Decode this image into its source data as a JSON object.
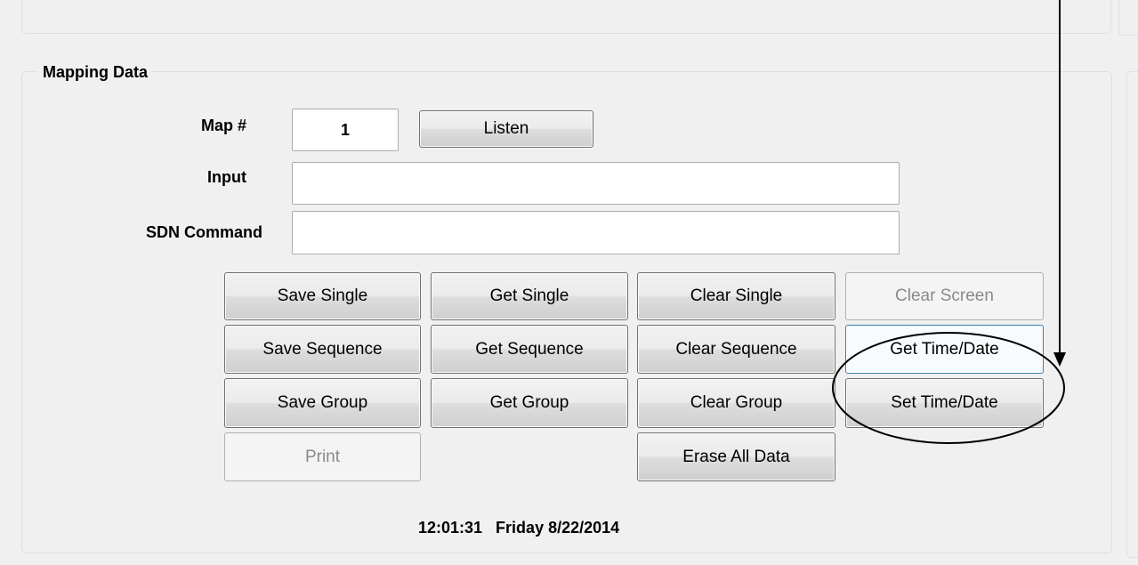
{
  "group": {
    "title": "Mapping Data"
  },
  "fields": {
    "map_label": "Map #",
    "map_value": "1",
    "input_label": "Input",
    "input_value": "",
    "sdn_label": "SDN Command",
    "sdn_value": ""
  },
  "buttons": {
    "listen": "Listen",
    "save_single": "Save Single",
    "get_single": "Get Single",
    "clear_single": "Clear Single",
    "clear_screen": "Clear Screen",
    "save_sequence": "Save Sequence",
    "get_sequence": "Get Sequence",
    "clear_sequence": "Clear Sequence",
    "get_time_date": "Get Time/Date",
    "save_group": "Save Group",
    "get_group": "Get Group",
    "clear_group": "Clear Group",
    "set_time_date": "Set Time/Date",
    "print": "Print",
    "erase_all": "Erase All Data"
  },
  "status": {
    "time_date": "12:01:31   Friday 8/22/2014"
  },
  "colors": {
    "window_bg": "#f0f0f0",
    "focus_border": "#3c7fb1",
    "annotation": "#000000"
  }
}
